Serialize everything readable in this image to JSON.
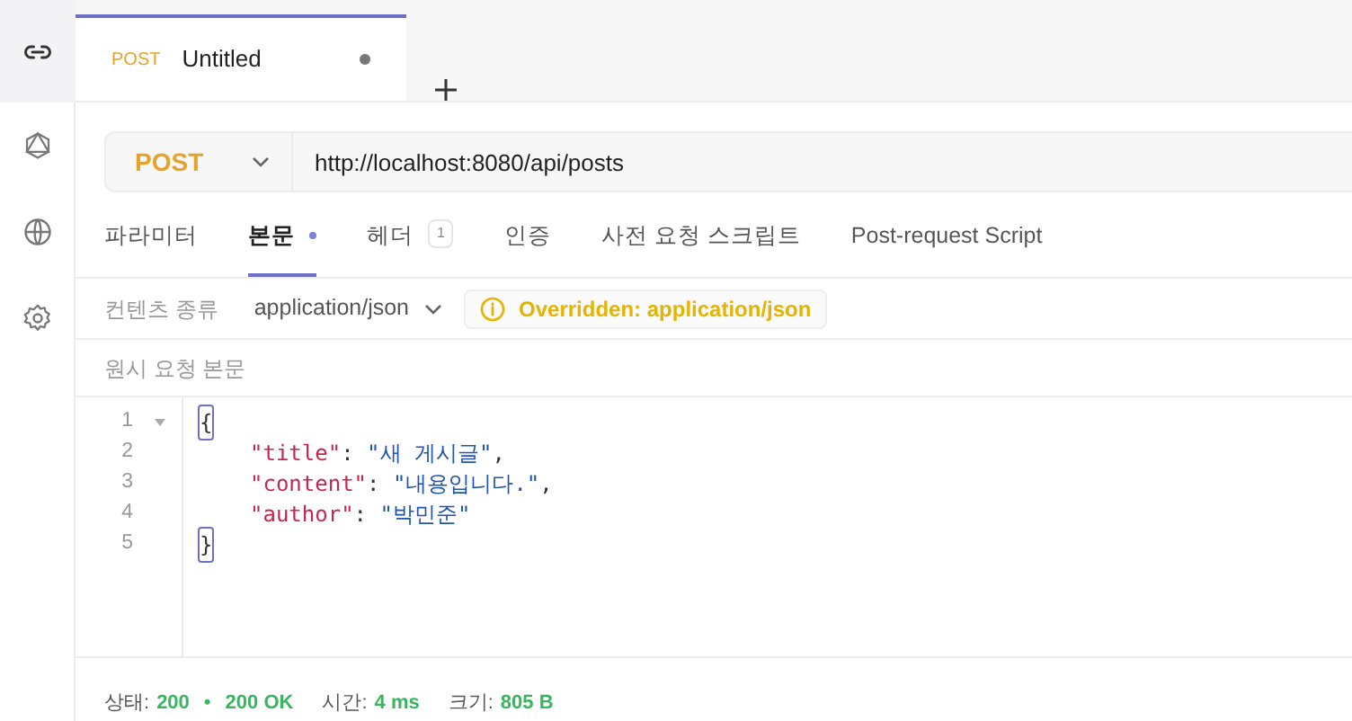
{
  "sidebar": {
    "items": [
      {
        "kind": "link",
        "selected": true
      },
      {
        "kind": "graph",
        "selected": false
      },
      {
        "kind": "globe",
        "selected": false
      },
      {
        "kind": "settings",
        "selected": false
      }
    ]
  },
  "tabs": [
    {
      "method": "POST",
      "title": "Untitled",
      "unsaved": true,
      "selected": true
    }
  ],
  "request": {
    "method": "POST",
    "url": "http://localhost:8080/api/posts"
  },
  "request_tabs": [
    {
      "label": "파라미터",
      "selected": false
    },
    {
      "label": "본문",
      "selected": true,
      "dot": true
    },
    {
      "label": "헤더",
      "selected": false,
      "count": "1"
    },
    {
      "label": "인증",
      "selected": false
    },
    {
      "label": "사전 요청 스크립트",
      "selected": false
    },
    {
      "label": "Post-request Script",
      "selected": false
    }
  ],
  "content_type": {
    "label": "컨텐츠 종류",
    "value": "application/json",
    "notice": "Overridden: application/json"
  },
  "body_label": "원시 요청 본문",
  "editor": {
    "lines": [
      {
        "number": "1",
        "foldable": true,
        "tokens": [
          {
            "kind": "bracket",
            "text": "{"
          }
        ]
      },
      {
        "number": "2",
        "foldable": false,
        "tokens": [
          {
            "kind": "key",
            "text": "\"title\""
          },
          {
            "kind": "punct",
            "text": ": "
          },
          {
            "kind": "string",
            "text": "\"새 게시글\""
          },
          {
            "kind": "punct",
            "text": ","
          }
        ]
      },
      {
        "number": "3",
        "foldable": false,
        "tokens": [
          {
            "kind": "key",
            "text": "\"content\""
          },
          {
            "kind": "punct",
            "text": ": "
          },
          {
            "kind": "string",
            "text": "\"내용입니다.\""
          },
          {
            "kind": "punct",
            "text": ","
          }
        ]
      },
      {
        "number": "4",
        "foldable": false,
        "tokens": [
          {
            "kind": "key",
            "text": "\"author\""
          },
          {
            "kind": "punct",
            "text": ": "
          },
          {
            "kind": "string",
            "text": "\"박민준\""
          }
        ]
      },
      {
        "number": "5",
        "foldable": false,
        "tokens": [
          {
            "kind": "bracket",
            "text": "}"
          }
        ]
      }
    ]
  },
  "status_bar": {
    "status_label": "상태:",
    "status_code": "200",
    "separator": "•",
    "status_text": "200 OK",
    "time_label": "시간:",
    "time": "4 ms",
    "size_label": "크기:",
    "size": "805 B"
  }
}
